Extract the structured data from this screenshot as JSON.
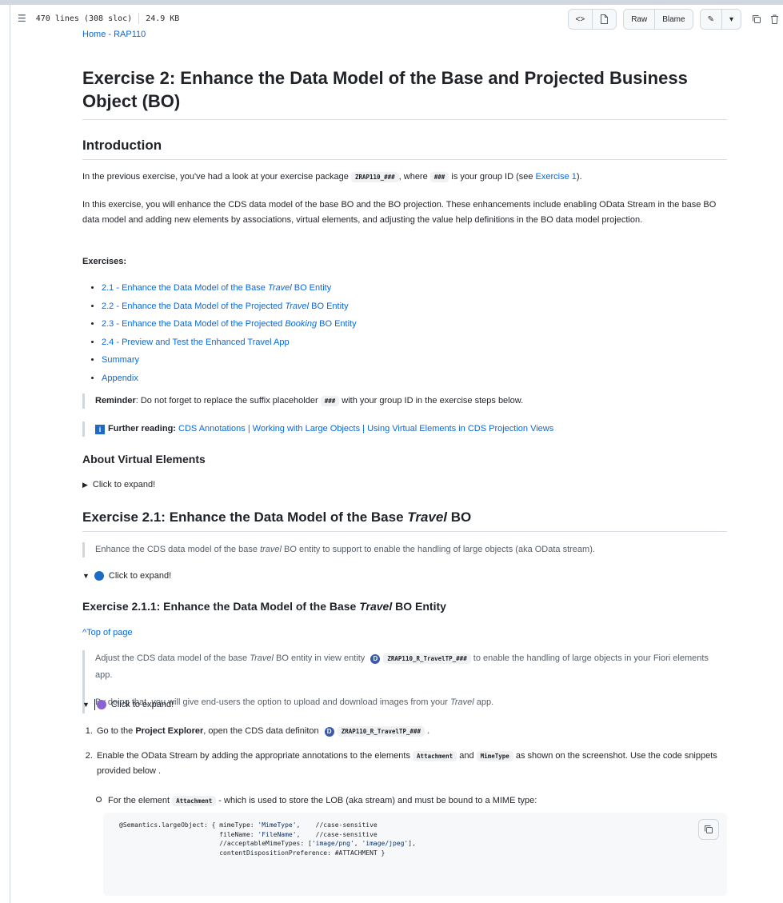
{
  "header": {
    "lines_info": "470 lines (308 sloc)",
    "size": "24.9 KB",
    "raw_label": "Raw",
    "blame_label": "Blame"
  },
  "breadcrumb": "Home - RAP110",
  "title": "Exercise 2: Enhance the Data Model of the Base and Projected Business Object (BO)",
  "intro": {
    "heading": "Introduction",
    "p1_a": "In the previous exercise, you've had a look at your exercise package ",
    "p1_code": "ZRAP110_###",
    "p1_b": ", where ",
    "p1_code2": "###",
    "p1_c": " is your group ID (see ",
    "p1_link": "Exercise 1",
    "p1_d": ").",
    "p2": "In this exercise, you will enhance the CDS data model of the base BO and the BO projection. These enhancements include enabling OData Stream in the base BO data model and adding new elements by associations, virtual elements, and adjusting the value help definitions in the BO data model projection."
  },
  "exercises": {
    "label": "Exercises:",
    "items": [
      {
        "pre": "2.1 - Enhance the Data Model of the Base ",
        "em": "Travel",
        "post": " BO Entity"
      },
      {
        "pre": "2.2 - Enhance the Data Model of the Projected ",
        "em": "Travel",
        "post": " BO Entity"
      },
      {
        "pre": "2.3 - Enhance the Data Model of the Projected ",
        "em": "Booking",
        "post": " BO Entity"
      },
      {
        "pre": "2.4 - Preview and Test the Enhanced Travel App",
        "em": "",
        "post": ""
      },
      {
        "pre": "Summary",
        "em": "",
        "post": ""
      },
      {
        "pre": "Appendix",
        "em": "",
        "post": ""
      }
    ]
  },
  "reminder": {
    "bold": "Reminder",
    "a": ": Do not forget to replace the suffix placeholder ",
    "code": "###",
    "b": " with your group ID in the exercise steps below."
  },
  "further": {
    "icon": "i",
    "bold": "Further reading:",
    "link1": "CDS Annotations",
    "sep": "|",
    "link2": "Working with Large Objects",
    "link3": "Using Virtual Elements in CDS Projection Views"
  },
  "virtual": {
    "heading": "About Virtual Elements",
    "expand": "Click to expand!"
  },
  "ex21": {
    "heading_pre": "Exercise 2.1: Enhance the Data Model of the Base ",
    "heading_em": "Travel",
    "heading_post": " BO",
    "quote_a": "Enhance the CDS data model of the base ",
    "quote_em": "travel",
    "quote_b": " BO entity to support to enable the handling of large objects (aka OData stream).",
    "expand": "Click to expand!"
  },
  "ex211": {
    "heading_pre": "Exercise 2.1.1: Enhance the Data Model of the Base ",
    "heading_em": "Travel",
    "heading_post": " BO Entity",
    "top_link": "^Top of page",
    "q1_a": "Adjust the CDS data model of the base ",
    "q1_em": "Travel",
    "q1_b": " BO entity in view entity ",
    "q1_d": "D",
    "q1_code": "ZRAP110_R_TravelTP_###",
    "q1_c": " to enable the handling of large objects in your Fiori elements app.",
    "q2_a": "By doing that, you will give end-users the option to upload and download images from your ",
    "q2_em": "Travel",
    "q2_b": " app.",
    "expand": "Click to expand!"
  },
  "steps": {
    "s1_a": "Go to the ",
    "s1_bold": "Project Explorer",
    "s1_b": ", open the CDS data definiton ",
    "s1_d": "D",
    "s1_code": "ZRAP110_R_TravelTP_###",
    "s1_c": ".",
    "s2_a": "Enable the OData Stream by adding the appropriate annotations to the elements ",
    "s2_code1": "Attachment",
    "s2_b": " and ",
    "s2_code2": "MimeType",
    "s2_c": " as shown on the screenshot. Use the code snippets provided below .",
    "sub_a": "For the element ",
    "sub_code": "Attachment",
    "sub_b": " - which is used to store the LOB (aka stream) and must be bound to a MIME type:"
  },
  "code": {
    "l1a": "@Semantics.largeObject: { mimeType: ",
    "l1s": "'MimeType'",
    "l1b": ",    //case-sensitive",
    "l2a": "                          fileName: ",
    "l2s": "'FileName'",
    "l2b": ",    //case-sensitive",
    "l3a": "                          //acceptableMimeTypes: [",
    "l3s": "'image/png', 'image/jpeg'",
    "l3b": "],",
    "l4": "                          contentDispositionPreference: #ATTACHMENT }"
  },
  "colors": {
    "link": "#0969da",
    "circle_blue": "#1e6bc6",
    "circle_purple": "#8a63d2"
  }
}
